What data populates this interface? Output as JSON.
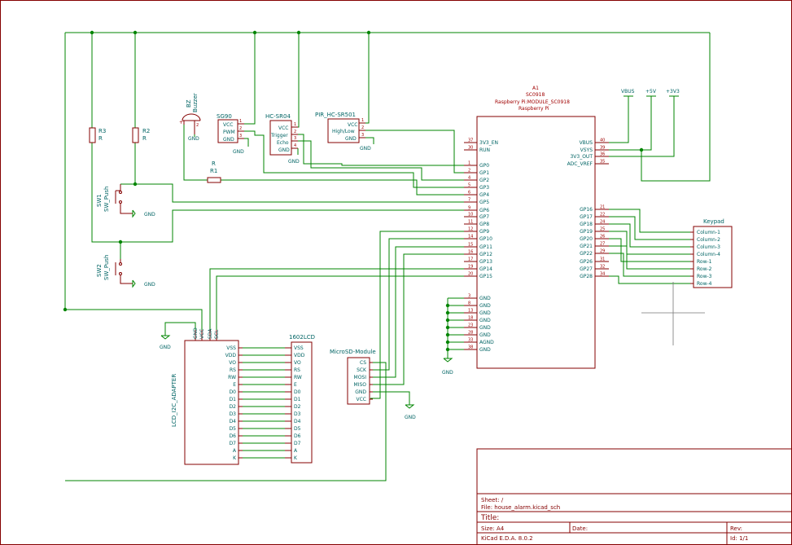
{
  "schematic": {
    "a1": {
      "ref": "A1",
      "value": "SC0918",
      "lib": "Raspberry Pi:MODULE_SC0918",
      "footprint": "Raspberry Pi",
      "left_pins": [
        {
          "num": "37",
          "name": "3V3_EN"
        },
        {
          "num": "30",
          "name": "RUN"
        },
        {
          "num": "1",
          "name": "GP0"
        },
        {
          "num": "2",
          "name": "GP1"
        },
        {
          "num": "4",
          "name": "GP2"
        },
        {
          "num": "5",
          "name": "GP3"
        },
        {
          "num": "6",
          "name": "GP4"
        },
        {
          "num": "7",
          "name": "GP5"
        },
        {
          "num": "9",
          "name": "GP6"
        },
        {
          "num": "10",
          "name": "GP7"
        },
        {
          "num": "11",
          "name": "GP8"
        },
        {
          "num": "12",
          "name": "GP9"
        },
        {
          "num": "14",
          "name": "GP10"
        },
        {
          "num": "15",
          "name": "GP11"
        },
        {
          "num": "16",
          "name": "GP12"
        },
        {
          "num": "17",
          "name": "GP13"
        },
        {
          "num": "19",
          "name": "GP14"
        },
        {
          "num": "20",
          "name": "GP15"
        },
        {
          "num": "3",
          "name": "GND"
        },
        {
          "num": "8",
          "name": "GND"
        },
        {
          "num": "13",
          "name": "GND"
        },
        {
          "num": "18",
          "name": "GND"
        },
        {
          "num": "23",
          "name": "GND"
        },
        {
          "num": "28",
          "name": "GND"
        },
        {
          "num": "33",
          "name": "AGND"
        },
        {
          "num": "38",
          "name": "GND"
        }
      ],
      "right_pins": [
        {
          "num": "40",
          "name": "VBUS"
        },
        {
          "num": "39",
          "name": "VSYS"
        },
        {
          "num": "36",
          "name": "3V3_OUT"
        },
        {
          "num": "35",
          "name": "ADC_VREF"
        },
        {
          "num": "21",
          "name": "GP16"
        },
        {
          "num": "22",
          "name": "GP17"
        },
        {
          "num": "24",
          "name": "GP18"
        },
        {
          "num": "25",
          "name": "GP19"
        },
        {
          "num": "26",
          "name": "GP20"
        },
        {
          "num": "27",
          "name": "GP21"
        },
        {
          "num": "29",
          "name": "GP22"
        },
        {
          "num": "31",
          "name": "GP26"
        },
        {
          "num": "32",
          "name": "GP27"
        },
        {
          "num": "34",
          "name": "GP28"
        }
      ]
    },
    "power": {
      "vbus": "VBUS",
      "p5v": "+5V",
      "p3v3": "+3V3",
      "gnd": "GND"
    },
    "buzzer": {
      "ref": "BZ",
      "value": "Buzzer",
      "pin1": "1",
      "pin2": "2"
    },
    "servo": {
      "ref": "SG90",
      "pins": [
        "VCC",
        "PWM",
        "GND"
      ],
      "nums": [
        "1",
        "2",
        "3"
      ]
    },
    "ultrasonic": {
      "ref": "HC-SR04",
      "pins": [
        "VCC",
        "Trigger",
        "Echo",
        "GND"
      ],
      "nums": [
        "1",
        "2",
        "3",
        "4"
      ]
    },
    "pir": {
      "ref": "PIR_HC-SR501",
      "pins": [
        "VCC",
        "High/Low",
        "GND"
      ],
      "nums": [
        "1",
        "2",
        "3"
      ]
    },
    "r1": {
      "ref": "R1",
      "value": "R"
    },
    "r2": {
      "ref": "R2",
      "value": "R"
    },
    "r3": {
      "ref": "R3",
      "value": "R"
    },
    "sw1": {
      "ref": "SW1",
      "value": "SW_Push"
    },
    "sw2": {
      "ref": "SW2",
      "value": "SW_Push"
    },
    "keypad": {
      "ref": "Keypad",
      "pins": [
        "Column-1",
        "Column-2",
        "Column-3",
        "Column-4",
        "Row-1",
        "Row-2",
        "Row-3",
        "Row-4"
      ]
    },
    "i2c": {
      "ref": "LCD_I2C_ADAPTER",
      "top_pins": [
        "GND",
        "VCC",
        "SDA",
        "SCL"
      ],
      "pins": [
        "VSS",
        "VDD",
        "VO",
        "RS",
        "RW",
        "E",
        "D0",
        "D1",
        "D2",
        "D3",
        "D4",
        "D5",
        "D6",
        "D7",
        "A",
        "K"
      ]
    },
    "lcd": {
      "ref": "1602LCD",
      "pins": [
        "VSS",
        "VDD",
        "VO",
        "RS",
        "RW",
        "E",
        "D0",
        "D1",
        "D2",
        "D3",
        "D4",
        "D5",
        "D6",
        "D7",
        "A",
        "K"
      ]
    },
    "sd": {
      "ref": "MicroSD-Module",
      "pins": [
        "CS",
        "SCK",
        "MOSI",
        "MISO",
        "GND",
        "VCC"
      ]
    }
  },
  "title_block": {
    "sheet": "Sheet: /",
    "file": "File: house_alarm.kicad_sch",
    "title": "Title:",
    "size": "Size: A4",
    "date": "Date:",
    "rev": "Rev:",
    "tool": "KiCad E.D.A. 8.0.2",
    "id": "Id: 1/1"
  }
}
